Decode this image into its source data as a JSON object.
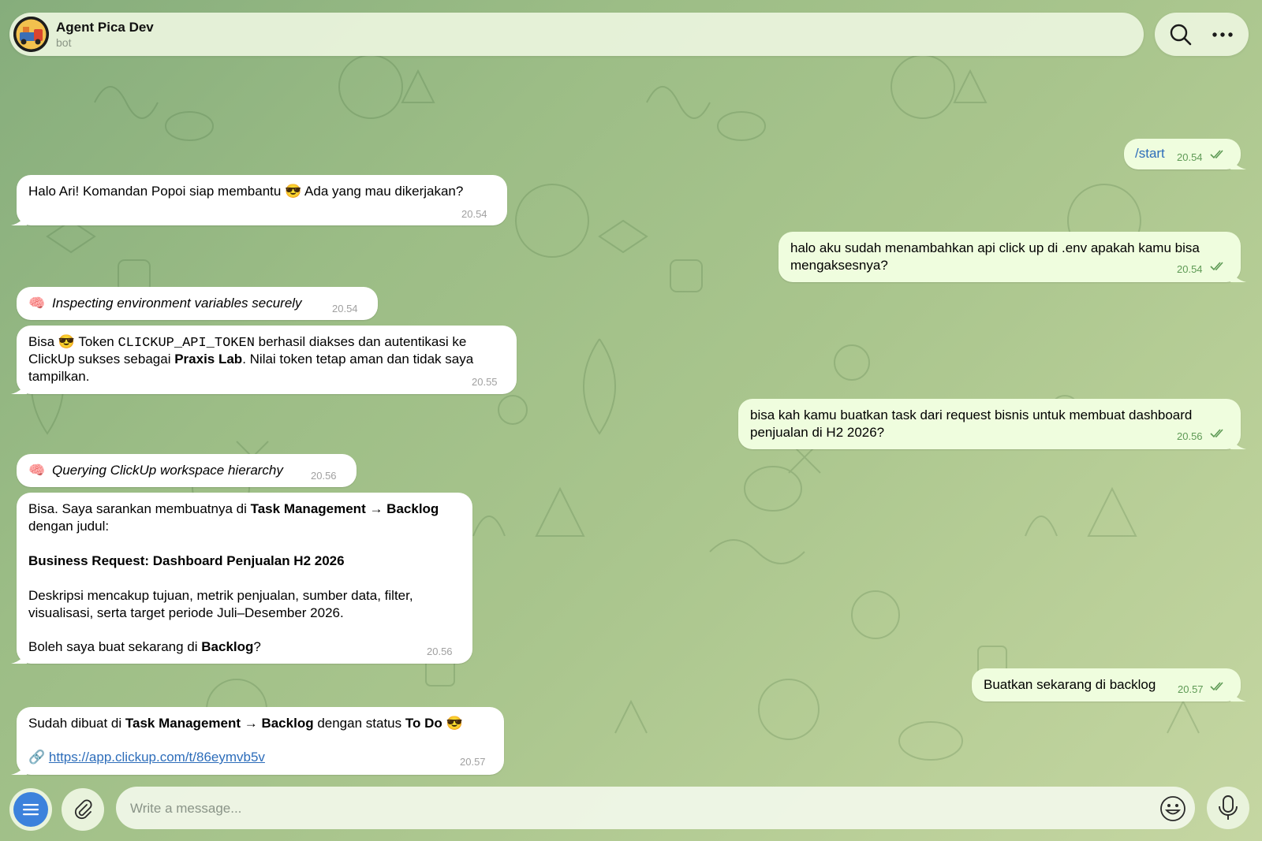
{
  "header": {
    "title": "Agent Pica Dev",
    "subtitle": "bot"
  },
  "messages": [
    {
      "id": "m1",
      "dir": "out",
      "text": "/start",
      "time": "20.54"
    },
    {
      "id": "m2",
      "dir": "in",
      "text": "Halo Ari! Komandan Popoi siap membantu 😎 Ada yang mau dikerjakan?",
      "time": "20.54"
    },
    {
      "id": "m3",
      "dir": "out",
      "lines": [
        "halo aku sudah menambahkan api click up di .env apakah kamu bisa",
        "mengaksesnya?"
      ],
      "time": "20.54"
    },
    {
      "id": "m4",
      "dir": "in",
      "emoji": "🧠",
      "text": "Inspecting environment variables securely",
      "time": "20.54"
    },
    {
      "id": "m5",
      "dir": "in",
      "parts": {
        "a": "Bisa 😎 Token ",
        "code": "CLICKUP_API_TOKEN",
        "b": " berhasil diakses dan autentikasi ke",
        "c": "ClickUp sukses sebagai ",
        "bold": "Praxis Lab",
        "d": ". Nilai token tetap aman dan tidak saya",
        "e": "tampilkan."
      },
      "time": "20.55"
    },
    {
      "id": "m6",
      "dir": "out",
      "lines": [
        "bisa kah kamu buatkan task dari request bisnis untuk membuat dashboard",
        "penjualan di H2 2026?"
      ],
      "time": "20.56"
    },
    {
      "id": "m7",
      "dir": "in",
      "emoji": "🧠",
      "text": "Querying ClickUp workspace hierarchy",
      "time": "20.56"
    },
    {
      "id": "m8",
      "dir": "in",
      "parts": {
        "a": "Bisa. Saya sarankan membuatnya di ",
        "bold1": "Task Management → Backlog",
        "b": "dengan judul:",
        "heading": "Business Request: Dashboard Penjualan H2 2026",
        "c": "Deskripsi mencakup tujuan, metrik penjualan, sumber data, filter,",
        "d": "visualisasi, serta target periode Juli–Desember 2026.",
        "e": "Boleh saya buat sekarang di ",
        "bold2": "Backlog",
        "f": "?"
      },
      "time": "20.56"
    },
    {
      "id": "m9",
      "dir": "out",
      "text": "Buatkan sekarang di backlog",
      "time": "20.57"
    },
    {
      "id": "m10",
      "dir": "in",
      "parts": {
        "a": "Sudah dibuat di ",
        "bold1": "Task Management → Backlog",
        "b": " dengan status ",
        "bold2": "To Do",
        "c": " 😎",
        "link_emoji": "🔗",
        "link": "https://app.clickup.com/t/86eymvb5v"
      },
      "time": "20.57"
    }
  ],
  "composer": {
    "placeholder": "Write a message..."
  },
  "icons": {
    "search": "search-icon",
    "more": "more-icon",
    "menu": "menu-icon",
    "attach": "paperclip-icon",
    "emoji": "emoji-icon",
    "mic": "microphone-icon"
  },
  "colors": {
    "outgoing_bubble": "#effdde",
    "incoming_bubble": "#ffffff",
    "accent": "#3c82dc",
    "link": "#2d6dba",
    "out_time": "#5e9a55"
  }
}
